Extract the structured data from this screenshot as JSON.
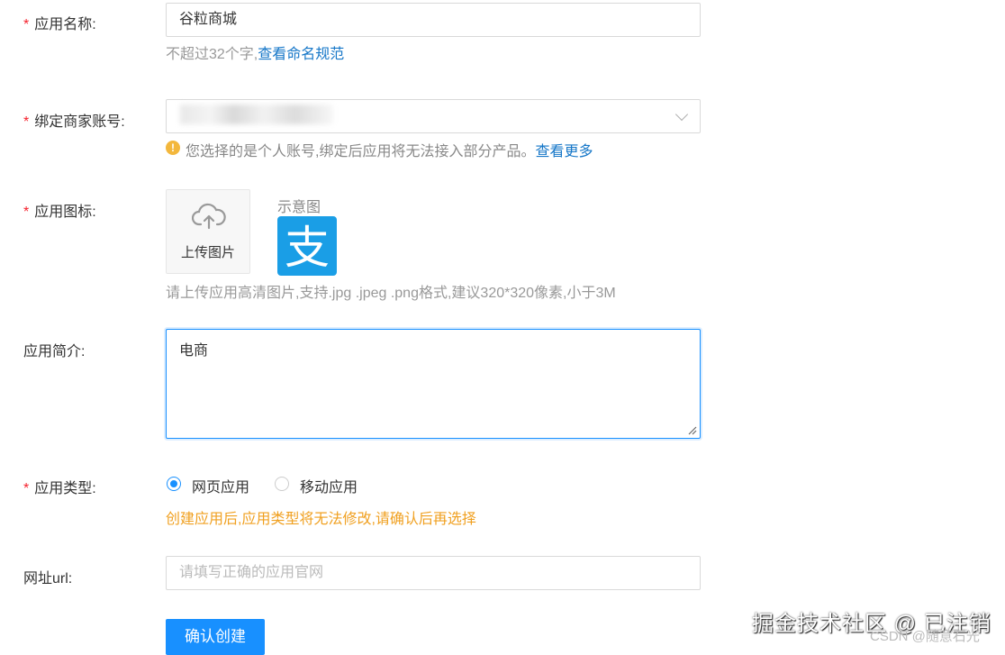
{
  "form": {
    "app_name": {
      "label": "应用名称:",
      "value": "谷粒商城",
      "hint": "不超过32个字,",
      "hint_link": "查看命名规范"
    },
    "merchant_account": {
      "label": "绑定商家账号:",
      "notice": "您选择的是个人账号,绑定后应用将无法接入部分产品。",
      "notice_link": "查看更多"
    },
    "app_icon": {
      "label": "应用图标:",
      "upload_text": "上传图片",
      "sample_label": "示意图",
      "sample_glyph": "支",
      "hint": "请上传应用高清图片,支持.jpg .jpeg .png格式,建议320*320像素,小于3M"
    },
    "app_intro": {
      "label": "应用简介:",
      "value": "电商"
    },
    "app_type": {
      "label": "应用类型:",
      "options": [
        "网页应用",
        "移动应用"
      ],
      "selected": "网页应用",
      "warning": "创建应用后,应用类型将无法修改,请确认后再选择"
    },
    "url": {
      "label": "网址url:",
      "placeholder": "请填写正确的应用官网"
    },
    "submit_label": "确认创建"
  },
  "watermark": {
    "main": "掘金技术社区 @ 已注销",
    "sub": "CSDN @随意石光"
  },
  "colors": {
    "primary": "#1890ff",
    "required": "#f5222d",
    "warning": "#f0a020",
    "link": "#1677c8"
  }
}
